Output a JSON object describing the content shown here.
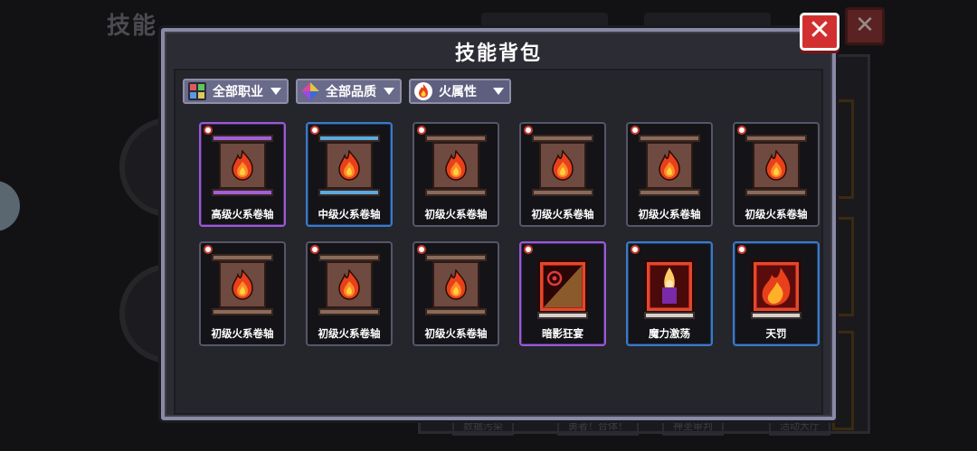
{
  "background": {
    "title": "技能",
    "bottom_labels": [
      "数据污染",
      "勇者！合体！",
      "神圣审判",
      "活动大厅"
    ]
  },
  "modal": {
    "title": "技能背包",
    "close_symbol": "✕"
  },
  "filters": [
    {
      "label": "全部职业",
      "icon": "class-grid-icon"
    },
    {
      "label": "全部品质",
      "icon": "quality-gem-icon"
    },
    {
      "label": "火属性",
      "icon": "fire-element-icon"
    }
  ],
  "items": [
    {
      "name": "高级火系卷轴",
      "kind": "scroll",
      "rarity": "epic",
      "badge": true
    },
    {
      "name": "中级火系卷轴",
      "kind": "scroll",
      "rarity": "rare",
      "badge": true
    },
    {
      "name": "初级火系卷轴",
      "kind": "scroll",
      "rarity": "common",
      "badge": true
    },
    {
      "name": "初级火系卷轴",
      "kind": "scroll",
      "rarity": "common",
      "badge": true
    },
    {
      "name": "初级火系卷轴",
      "kind": "scroll",
      "rarity": "common",
      "badge": true
    },
    {
      "name": "初级火系卷轴",
      "kind": "scroll",
      "rarity": "common",
      "badge": true
    },
    {
      "name": "初级火系卷轴",
      "kind": "scroll",
      "rarity": "common",
      "badge": true
    },
    {
      "name": "初级火系卷轴",
      "kind": "scroll",
      "rarity": "common",
      "badge": true
    },
    {
      "name": "初级火系卷轴",
      "kind": "scroll",
      "rarity": "common",
      "badge": true
    },
    {
      "name": "暗影狂宴",
      "kind": "book",
      "rarity": "epic",
      "badge": true,
      "art": "shadow-feast"
    },
    {
      "name": "魔力激荡",
      "kind": "book",
      "rarity": "rare",
      "badge": true,
      "art": "mana-surge"
    },
    {
      "name": "天罚",
      "kind": "book",
      "rarity": "rare",
      "badge": true,
      "art": "heavenly-punishment"
    }
  ],
  "colors": {
    "epic": "#9a5ad6",
    "rare": "#3a7ac8",
    "close": "#d23030",
    "flame_outer": "#e8401a",
    "flame_inner": "#ffd23a"
  }
}
